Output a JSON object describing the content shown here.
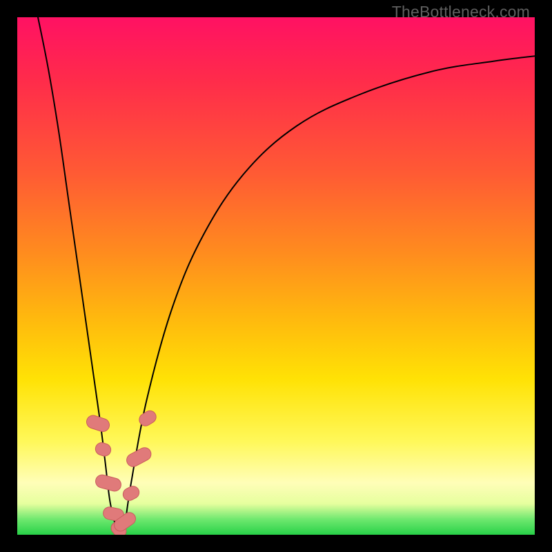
{
  "watermark": "TheBottleneck.com",
  "chart_data": {
    "type": "line",
    "title": "",
    "subtitle": "",
    "xlabel": "",
    "ylabel": "",
    "xlim": [
      0,
      100
    ],
    "ylim": [
      0,
      100
    ],
    "legend": false,
    "grid": false,
    "background_gradient": {
      "orientation": "vertical",
      "stops": [
        {
          "pos": 0.0,
          "color": "#ff1163"
        },
        {
          "pos": 0.12,
          "color": "#ff2b4b"
        },
        {
          "pos": 0.3,
          "color": "#ff5a34"
        },
        {
          "pos": 0.45,
          "color": "#ff8a1f"
        },
        {
          "pos": 0.58,
          "color": "#ffb80e"
        },
        {
          "pos": 0.7,
          "color": "#ffe205"
        },
        {
          "pos": 0.82,
          "color": "#fff85a"
        },
        {
          "pos": 0.9,
          "color": "#fffeb8"
        },
        {
          "pos": 0.94,
          "color": "#e6ff9e"
        },
        {
          "pos": 0.97,
          "color": "#6fe86f"
        },
        {
          "pos": 1.0,
          "color": "#28d148"
        }
      ]
    },
    "series": [
      {
        "name": "curve",
        "color": "#000000",
        "stroke_width": 2,
        "x": [
          4.0,
          6.0,
          8.0,
          10.0,
          12.0,
          14.0,
          16.0,
          17.0,
          18.0,
          19.5,
          20.5,
          22.0,
          25.0,
          30.0,
          36.0,
          44.0,
          54.0,
          66.0,
          80.0,
          92.0,
          100.0
        ],
        "y": [
          100.0,
          90.0,
          78.0,
          64.0,
          50.0,
          36.0,
          22.0,
          14.0,
          6.0,
          0.5,
          0.5,
          10.0,
          26.0,
          44.0,
          58.0,
          70.0,
          79.0,
          85.0,
          89.5,
          91.5,
          92.5
        ]
      }
    ],
    "markers": {
      "name": "beads",
      "shape": "rounded-rect",
      "fill": "#e07a7a",
      "stroke": "#c95c5c",
      "points": [
        {
          "x": 15.6,
          "y": 21.5,
          "rot": -72,
          "w": 2.5,
          "h": 4.5
        },
        {
          "x": 16.6,
          "y": 16.5,
          "rot": -72,
          "w": 2.4,
          "h": 3.0
        },
        {
          "x": 17.6,
          "y": 10.0,
          "rot": -75,
          "w": 2.5,
          "h": 5.0
        },
        {
          "x": 18.6,
          "y": 4.0,
          "rot": -78,
          "w": 2.4,
          "h": 4.0
        },
        {
          "x": 19.6,
          "y": 1.0,
          "rot": -40,
          "w": 2.4,
          "h": 3.2
        },
        {
          "x": 20.8,
          "y": 2.5,
          "rot": 55,
          "w": 2.4,
          "h": 4.5
        },
        {
          "x": 22.0,
          "y": 8.0,
          "rot": 62,
          "w": 2.4,
          "h": 3.2
        },
        {
          "x": 23.5,
          "y": 15.0,
          "rot": 62,
          "w": 2.5,
          "h": 5.0
        },
        {
          "x": 25.2,
          "y": 22.5,
          "rot": 58,
          "w": 2.4,
          "h": 3.4
        }
      ]
    }
  }
}
